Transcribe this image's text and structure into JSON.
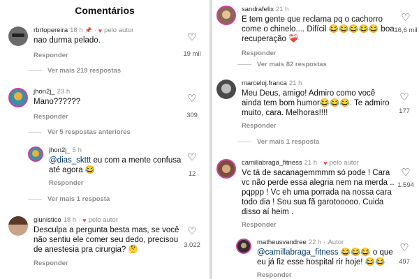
{
  "left": {
    "title": "Comentários",
    "c1": {
      "user": "rbrtopereira",
      "time": "18 h",
      "by_author": "pelo autor",
      "text": "nao durma pelado.",
      "reply": "Responder",
      "likes": "19 mil"
    },
    "more1": "Ver mais 219 respostas",
    "c2": {
      "user": "jhon2j_",
      "time": "23 h",
      "text": "Mano??????",
      "reply": "Responder",
      "likes": "309"
    },
    "prev2": "Ver 5 respostas anteriores",
    "c3": {
      "user": "jhon2j_",
      "time": "5 h",
      "mention": "@dias_skttt",
      "text": " eu com a mente confusa até agora 😂",
      "reply": "Responder",
      "likes": "12"
    },
    "more3": "Ver mais 1 resposta",
    "c4": {
      "user": "giunistico",
      "time": "18 h",
      "by_author": "pelo autor",
      "text": "Desculpa a pergunta besta mas, se você não sentiu ele comer seu dedo, precisou de anestesia pra cirurgia? 🤔",
      "reply": "Responder",
      "likes": "3.022"
    }
  },
  "right": {
    "c5": {
      "user": "sandrafelix",
      "time": "21 h",
      "text": "E tem gente que reclama pq o cachorro come o chinelo.... Difícil 😂😂😂😂😂 boa recuperação ❤️‍🩹",
      "reply": "Responder",
      "likes": "16,6 mil"
    },
    "more5": "Ver mais 82 respostas",
    "c6": {
      "user": "marceloj.franca",
      "time": "21 h",
      "text": "Meu Deus, amigo! Admiro como você ainda tem bom humor😂😂😂. Te admiro muito, cara. Melhoras!!!!",
      "reply": "Responder",
      "likes": "177"
    },
    "more6": "Ver mais 1 resposta",
    "c7": {
      "user": "camillabraga_fitness",
      "time": "21 h",
      "by_author": "pelo autor",
      "text": "Vc tá de sacanagemmmm só pode ! Cara vc não perde essa alegria nem na merda .. pqppp ! Vc eh uma porrada na nossa cara todo dia ! Sou sua fã garotooooo.  Cuida disso aí heim .",
      "reply": "Responder",
      "likes": "1.594"
    },
    "c8": {
      "user": "matheusvandree",
      "time": "22 h",
      "author": "Autor",
      "mention": "@camillabraga_fitness",
      "text": " 😂😂😂 o que eu já fiz esse hospital rir hoje! 😂😂",
      "reply": "Responder",
      "likes": "497"
    }
  }
}
